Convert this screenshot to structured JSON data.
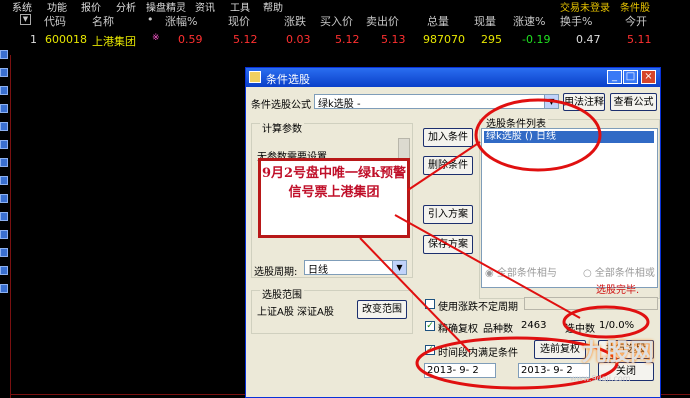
{
  "menu": {
    "items": [
      "系统",
      "功能",
      "报价",
      "分析",
      "操盘精灵",
      "资讯",
      "工具",
      "帮助"
    ],
    "right": [
      "交易未登录",
      "条件股"
    ]
  },
  "quote_header": {
    "columns": [
      "代码",
      "名称",
      "•",
      "涨幅%",
      "现价",
      "涨跌",
      "买入价",
      "卖出价",
      "总量",
      "现量",
      "涨速%",
      "换手%",
      "今开"
    ]
  },
  "quote_row": {
    "index": "1",
    "code": "600018",
    "name": "上港集团",
    "flag": "※",
    "change_pct": "0.59",
    "price": "5.12",
    "change": "0.03",
    "bid": "5.12",
    "ask": "5.13",
    "volume": "987070",
    "cur_volume": "295",
    "speed": "-0.19",
    "turnover": "0.47",
    "open": "5.11"
  },
  "dialog": {
    "title": "条件选股",
    "formula_label": "条件选股公式",
    "formula_value": "绿k选股  -",
    "usage_button": "用法注释",
    "view_formula_button": "查看公式",
    "params_group": "计算参数",
    "params_text": "无参数需要设置",
    "conditions_group": "选股条件列表",
    "condition_item": "绿k选股  () 日线",
    "add_condition": "加入条件",
    "delete_condition": "删除条件",
    "import_plan": "引入方案",
    "save_plan": "保存方案",
    "period_label": "选股周期:",
    "period_value": "日线",
    "all_and": "全部条件相与",
    "all_or": "全部条件相或",
    "done": "选股完毕.",
    "range_group": "选股范围",
    "range_text": "上证A股  深证A股",
    "change_range": "改变范围",
    "use_rights": "使用涨跌不定周期",
    "exact_rights": "精确复权",
    "count_label": "品种数",
    "count_value": "2463",
    "selected_label": "选中数",
    "selected_value": "1/0.0%",
    "time_segment": "时间段内满足条件",
    "pre_select": "选前复权",
    "execute": "执行选股",
    "date_from": "2013- 9- 2",
    "date_to": "2013- 9- 2",
    "close": "关闭"
  },
  "annotation": {
    "text": "9月2号盘中唯一绿k预警信号票上港集团"
  },
  "watermark": {
    "logo": "九股网",
    "url": "www.9daji.com"
  },
  "colors": {
    "red": "#ff3030",
    "green": "#20e020",
    "yellow": "#e6e600",
    "annot": "#c0102a"
  }
}
